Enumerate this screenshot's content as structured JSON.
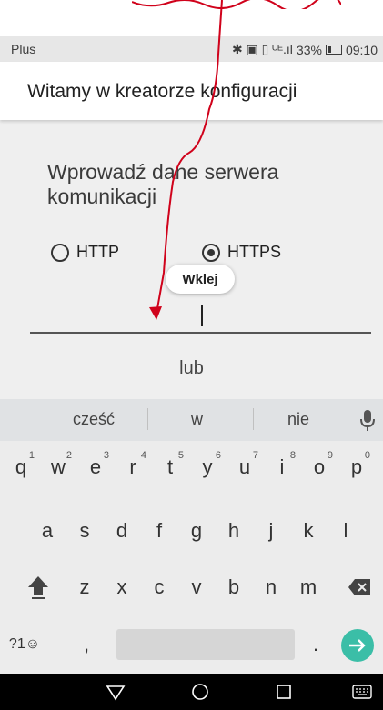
{
  "status_bar": {
    "carrier": "Plus",
    "indicators": "✱ ▣ ▯ ᵁᴱ.ıl",
    "battery": "33%",
    "time": "09:10"
  },
  "app_bar": {
    "title": "Witamy w kreatorze konfiguracji"
  },
  "form": {
    "heading": "Wprowadź dane serwera komunikacji",
    "protocol_options": [
      "HTTP",
      "HTTPS"
    ],
    "selected_protocol": "HTTPS",
    "server_input_value": "",
    "paste_tooltip": "Wklej",
    "or_label": "lub"
  },
  "keyboard": {
    "suggestions": [
      "cześć",
      "w",
      "nie"
    ],
    "row1": [
      "q",
      "w",
      "e",
      "r",
      "t",
      "y",
      "u",
      "i",
      "o",
      "p"
    ],
    "row1_numbers": [
      "1",
      "2",
      "3",
      "4",
      "5",
      "6",
      "7",
      "8",
      "9",
      "0"
    ],
    "row2": [
      "a",
      "s",
      "d",
      "f",
      "g",
      "h",
      "j",
      "k",
      "l"
    ],
    "row3": [
      "z",
      "x",
      "c",
      "v",
      "b",
      "n",
      "m"
    ],
    "symbols_key": "?1☺",
    "comma_key": ",",
    "period_key": "."
  },
  "icons": {
    "shift": "shift-icon",
    "backspace": "backspace-icon",
    "enter": "arrow-right-icon",
    "mic": "microphone-icon",
    "nav_back": "triangle-back-icon",
    "nav_home": "circle-home-icon",
    "nav_recents": "square-recents-icon",
    "nav_keyboard": "keyboard-icon"
  },
  "colors": {
    "accent_teal": "#3bbea7",
    "annotation_red": "#d0021b",
    "content_bg": "#efefef",
    "keyboard_bg": "#ececec"
  }
}
